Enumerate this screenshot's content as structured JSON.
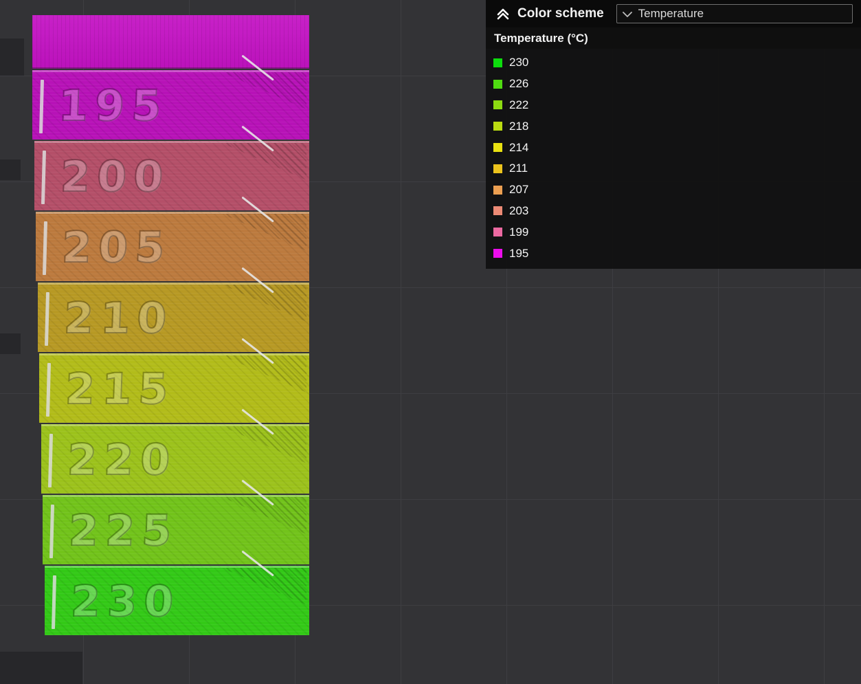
{
  "viewport": {
    "background": "#333336",
    "grid_color": "#3e3e42"
  },
  "legend_panel": {
    "header": {
      "collapse_icon": "chevron-double-up-icon",
      "title": "Color scheme",
      "dropdown": {
        "icon": "chevron-down-icon",
        "value": "Temperature"
      }
    },
    "subtitle": "Temperature (°C)",
    "items": [
      {
        "label": "230",
        "color": "#0ddd0d"
      },
      {
        "label": "226",
        "color": "#4fdb11"
      },
      {
        "label": "222",
        "color": "#8cdb11"
      },
      {
        "label": "218",
        "color": "#badb11"
      },
      {
        "label": "214",
        "color": "#e9e111"
      },
      {
        "label": "211",
        "color": "#ecc31d"
      },
      {
        "label": "207",
        "color": "#ec9f51"
      },
      {
        "label": "203",
        "color": "#ec8a75"
      },
      {
        "label": "199",
        "color": "#ec69a1"
      },
      {
        "label": "195",
        "color": "#ec0dec"
      }
    ]
  },
  "tower": {
    "top_plate": {
      "color": "#c513c5"
    },
    "blocks": [
      {
        "label": "195",
        "color": "#b712b7"
      },
      {
        "label": "200",
        "color": "#b44f68"
      },
      {
        "label": "205",
        "color": "#bc7a3e"
      },
      {
        "label": "210",
        "color": "#b79924"
      },
      {
        "label": "215",
        "color": "#b2bc1a"
      },
      {
        "label": "220",
        "color": "#9cc21c"
      },
      {
        "label": "225",
        "color": "#72c31b"
      },
      {
        "label": "230",
        "color": "#33c917"
      }
    ]
  }
}
